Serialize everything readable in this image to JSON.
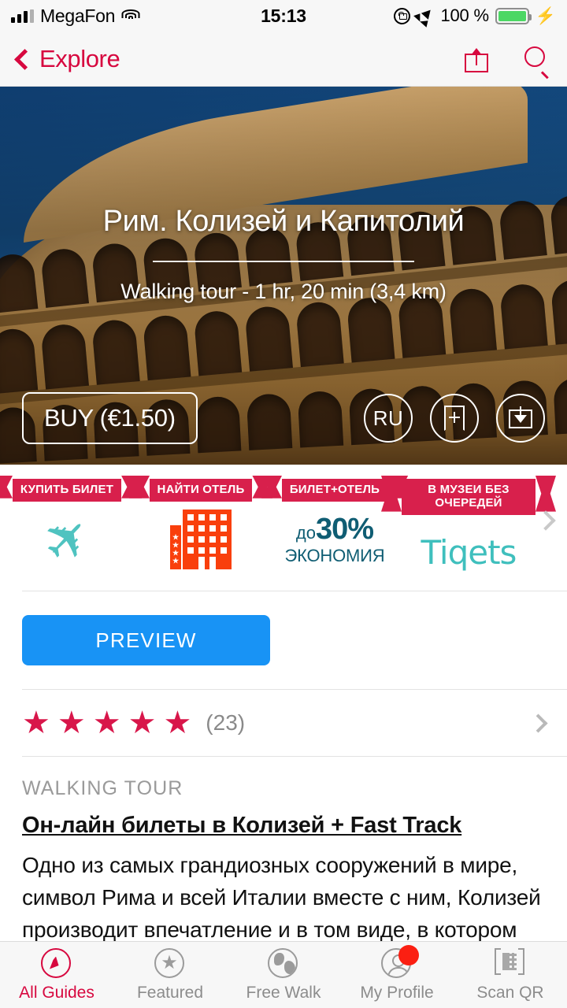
{
  "status_bar": {
    "carrier": "MegaFon",
    "time": "15:13",
    "battery_percent": "100 %",
    "icons": [
      "signal-icon",
      "wifi-icon",
      "rotation-lock-icon",
      "location-arrow-icon",
      "battery-icon",
      "charging-bolt-icon"
    ]
  },
  "nav_bar": {
    "back_label": "Explore",
    "share_icon": "share-icon",
    "search_icon": "search-icon",
    "accent_color": "#d7083f"
  },
  "hero": {
    "title": "Рим. Колизей и Капитолий",
    "subtitle": "Walking tour - 1 hr, 20 min (3,4 km)",
    "buy_label": "BUY (€1.50)",
    "language": "RU",
    "bookmark_icon": "bookmark-plus-icon",
    "download_icon": "download-icon"
  },
  "promos": {
    "items": [
      {
        "ribbon": "КУПИТЬ БИЛЕТ",
        "art": "airplane-icon",
        "art_color": "#4fc3c0"
      },
      {
        "ribbon": "НАЙТИ ОТЕЛЬ",
        "art": "hotel-building-icon",
        "art_color": "#f93f0c",
        "stars": "★★★★"
      },
      {
        "ribbon": "БИЛЕТ+ОТЕЛЬ",
        "art": "discount-text",
        "prefix": "до",
        "percent": "30%",
        "caption": "ЭКОНОМИЯ",
        "art_color": "#0f5d73"
      },
      {
        "ribbon": "В МУЗЕИ БЕЗ ОЧЕРЕДЕЙ",
        "art": "tiqets-logo",
        "logo_text": "Tiqets",
        "art_color": "#3fbfbd"
      }
    ],
    "ribbon_color": "#d8204c",
    "next_icon": "chevron-right-icon"
  },
  "preview": {
    "label": "PREVIEW",
    "color": "#1893f5"
  },
  "rating": {
    "stars_filled": 5,
    "star_glyph": "★",
    "count": "(23)",
    "color": "#d8164a",
    "chevron": "chevron-right-icon"
  },
  "article": {
    "kicker": "WALKING TOUR",
    "headline": "Он-лайн билеты в Колизей + Fast Track",
    "body": "Одно из самых грандиозных сооружений в мире, символ Рима и всей Италии вместе с ним, Колизей производит впечатление и в том виде, в котором он"
  },
  "tab_bar": {
    "tabs": [
      {
        "label": "All Guides",
        "icon": "compass-icon",
        "active": true
      },
      {
        "label": "Featured",
        "icon": "star-circle-icon",
        "active": false
      },
      {
        "label": "Free Walk",
        "icon": "globe-icon",
        "active": false
      },
      {
        "label": "My Profile",
        "icon": "person-icon",
        "active": false,
        "badge": true
      },
      {
        "label": "Scan QR",
        "icon": "qr-code-icon",
        "active": false
      }
    ]
  }
}
